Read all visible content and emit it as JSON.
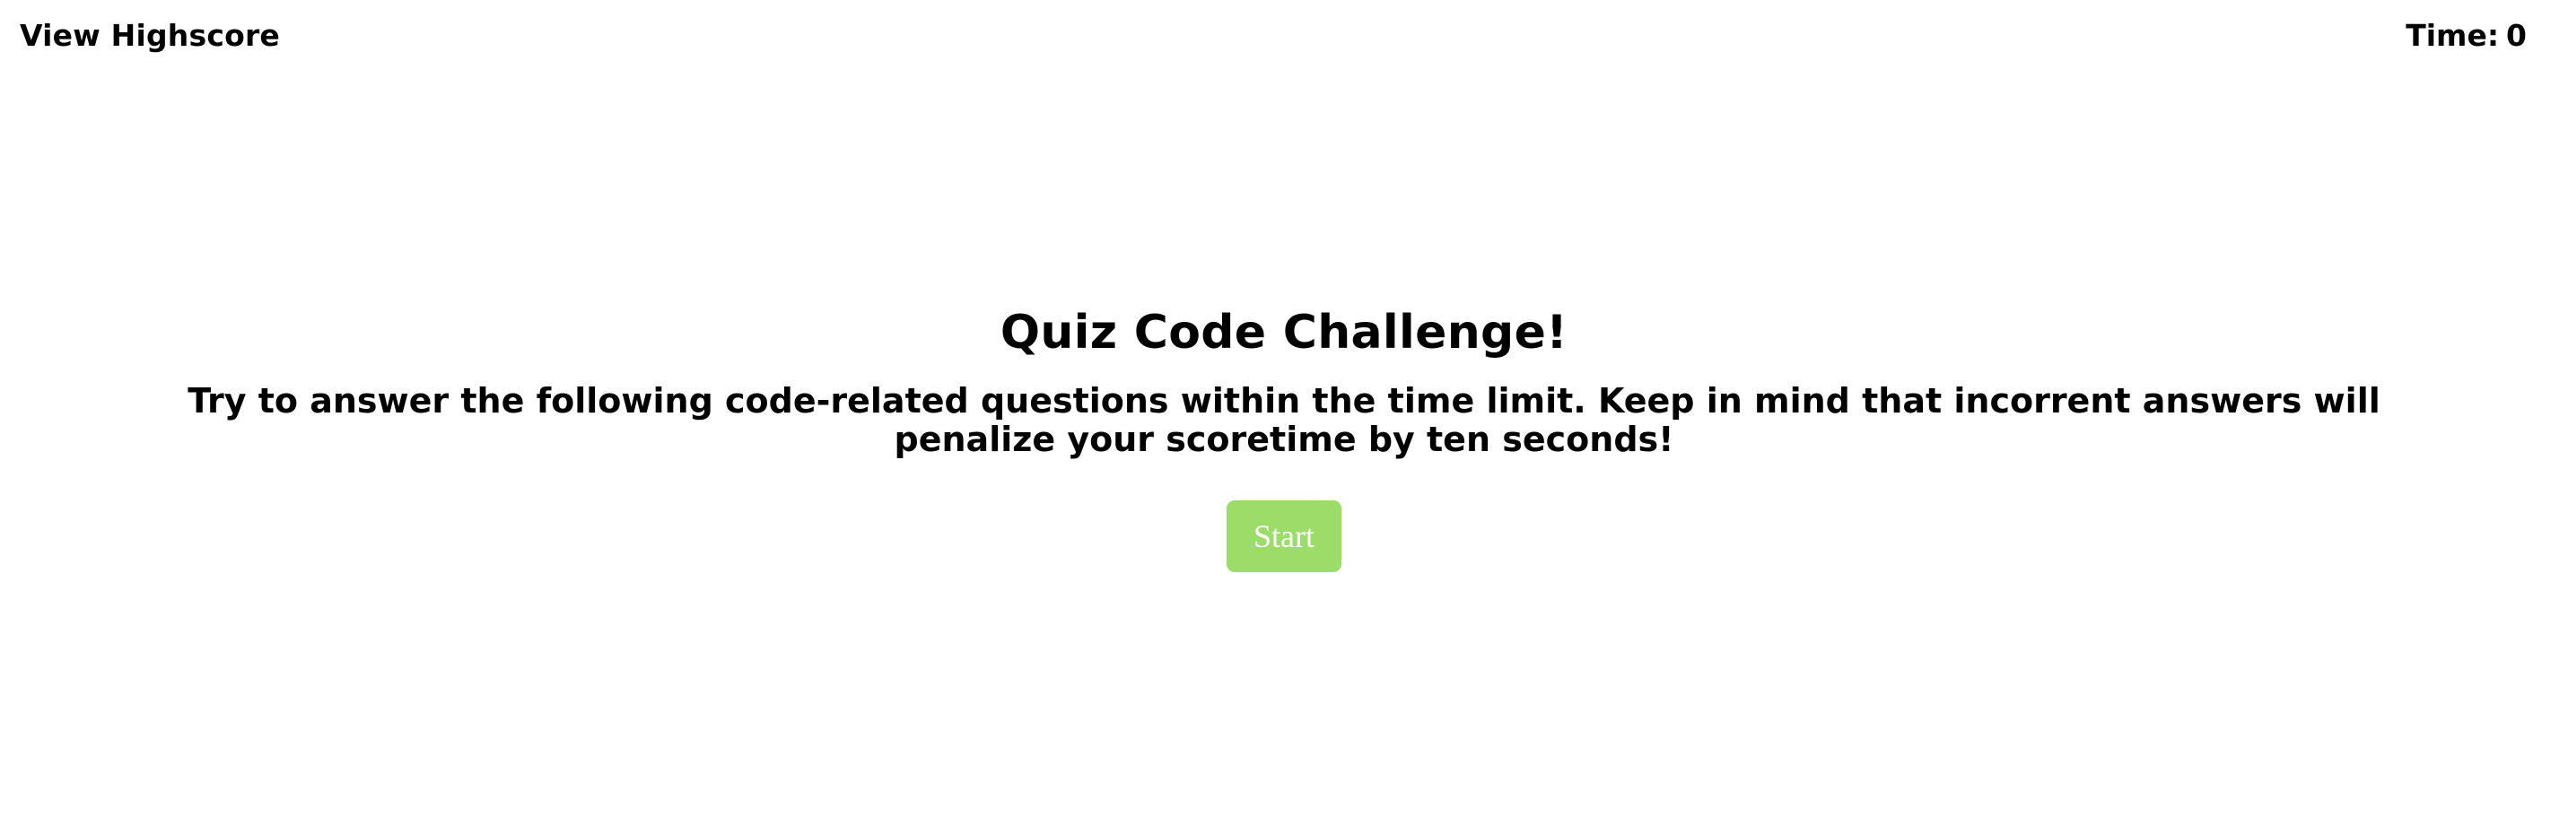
{
  "header": {
    "highscore_label": "View Highscore",
    "timer_label": "Time:",
    "timer_value": "0"
  },
  "intro": {
    "title": "Quiz Code Challenge!",
    "description": "Try to answer the following code-related questions within the time limit. Keep in mind that incorrent answers will penalize your scoretime by ten seconds!",
    "start_label": "Start"
  },
  "colors": {
    "start_button_bg": "#9cdc68",
    "start_button_text": "#ffffff",
    "text": "#000000",
    "background": "#ffffff"
  }
}
